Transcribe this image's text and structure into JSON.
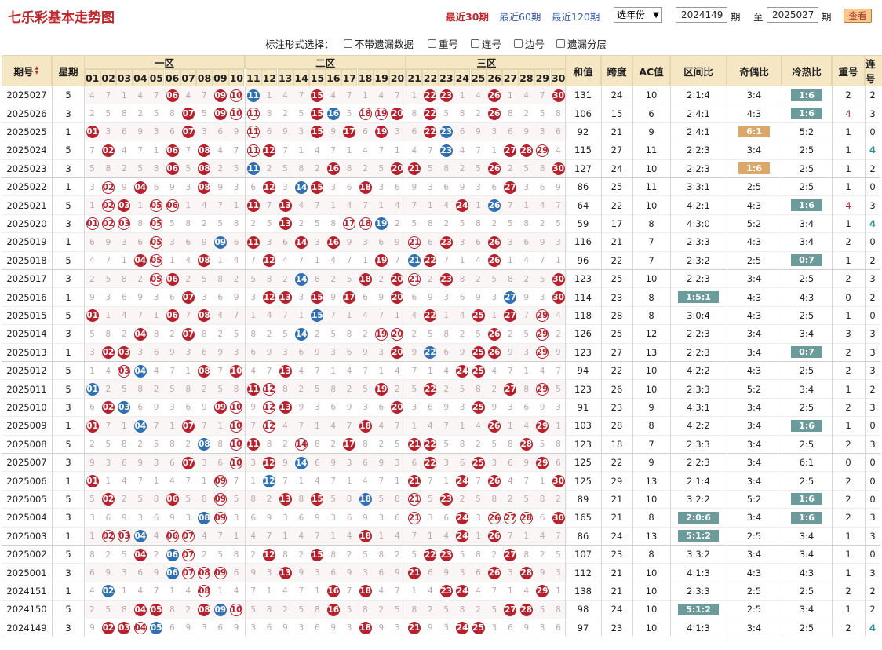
{
  "page": {
    "title": "七乐彩基本走势图",
    "periods": [
      "最近30期",
      "最近60期",
      "最近120期"
    ],
    "year_select": "选年份",
    "from_issue": "2024149",
    "to_issue": "2025027",
    "label_qi": "期",
    "label_to": "至",
    "view_button": "查看"
  },
  "options": {
    "label": "标注形式选择：",
    "items": [
      "不带遗漏数据",
      "重号",
      "连号",
      "边号",
      "遗漏分层"
    ]
  },
  "header": {
    "issue": "期号",
    "weekday": "星期",
    "zones": [
      "一区",
      "二区",
      "三区"
    ],
    "numbers": [
      "01",
      "02",
      "03",
      "04",
      "05",
      "06",
      "07",
      "08",
      "09",
      "10",
      "11",
      "12",
      "13",
      "14",
      "15",
      "16",
      "17",
      "18",
      "19",
      "20",
      "21",
      "22",
      "23",
      "24",
      "25",
      "26",
      "27",
      "28",
      "29",
      "30"
    ],
    "sum": "和值",
    "span": "跨度",
    "ac": "AC值",
    "zone_ratio": "区间比",
    "odd_even": "奇偶比",
    "hot_cold": "冷热比",
    "repeat": "重号",
    "consecutive": "连号"
  },
  "colors": {
    "red_ball": "#b8212c",
    "blue_ball": "#2f6fb3",
    "header_bg": "#f5e6c4",
    "title": "#c0272d",
    "badge_teal": "#6b9b9a",
    "badge_orange": "#dba86a"
  },
  "rows": [
    {
      "issue": "2025027",
      "wk": "5",
      "red": [
        6,
        9,
        15,
        22,
        23,
        26,
        30
      ],
      "blue": [
        11
      ],
      "ring": [
        10
      ],
      "sum": "131",
      "span": "24",
      "ac": "10",
      "zr": "2:1:4",
      "oe": "3:4",
      "hc": "1:6",
      "hcb": "teal",
      "rep": "2",
      "con": "2"
    },
    {
      "issue": "2025026",
      "wk": "3",
      "red": [
        7,
        9,
        15,
        20,
        22,
        26
      ],
      "blue": [
        16
      ],
      "ring": [
        10,
        11,
        18,
        19
      ],
      "sum": "106",
      "span": "15",
      "ac": "6",
      "zr": "2:4:1",
      "oe": "4:3",
      "hc": "1:6",
      "hcb": "teal",
      "rep": "4",
      "repc": "red",
      "con": "3"
    },
    {
      "issue": "2025025",
      "wk": "1",
      "red": [
        1,
        7,
        15,
        17,
        19,
        22
      ],
      "blue": [
        23
      ],
      "ring": [
        11
      ],
      "sum": "92",
      "span": "21",
      "ac": "9",
      "zr": "2:4:1",
      "oe": "6:1",
      "oeb": "orange",
      "hc": "5:2",
      "rep": "1",
      "con": "0"
    },
    {
      "issue": "2025024",
      "wk": "5",
      "red": [
        2,
        6,
        8,
        12,
        27,
        28
      ],
      "blue": [
        23
      ],
      "ring": [
        11,
        29
      ],
      "sum": "115",
      "span": "27",
      "ac": "11",
      "zr": "2:2:3",
      "oe": "3:4",
      "hc": "2:5",
      "rep": "1",
      "con": "4",
      "conc": "teal"
    },
    {
      "issue": "2025023",
      "wk": "3",
      "red": [
        6,
        8,
        16,
        20,
        21,
        26,
        30
      ],
      "blue": [
        11
      ],
      "ring": [],
      "sum": "127",
      "span": "24",
      "ac": "10",
      "zr": "2:2:3",
      "oe": "1:6",
      "oeb": "orange",
      "hc": "2:5",
      "rep": "1",
      "con": "2"
    },
    {
      "issue": "2025022",
      "wk": "1",
      "red": [
        4,
        8,
        12,
        15,
        18,
        27
      ],
      "blue": [
        14
      ],
      "ring": [
        2
      ],
      "sum": "86",
      "span": "25",
      "ac": "11",
      "zr": "3:3:1",
      "oe": "2:5",
      "hc": "2:5",
      "rep": "1",
      "con": "0"
    },
    {
      "issue": "2025021",
      "wk": "5",
      "red": [
        3,
        11,
        13,
        24
      ],
      "blue": [
        26
      ],
      "ring": [
        2,
        5,
        6
      ],
      "sum": "64",
      "span": "22",
      "ac": "10",
      "zr": "4:2:1",
      "oe": "4:3",
      "hc": "1:6",
      "hcb": "teal",
      "rep": "4",
      "repc": "red",
      "con": "3"
    },
    {
      "issue": "2025020",
      "wk": "3",
      "red": [
        13
      ],
      "blue": [
        19
      ],
      "ring": [
        1,
        2,
        3,
        5,
        17,
        18
      ],
      "sum": "59",
      "span": "17",
      "ac": "8",
      "zr": "4:3:0",
      "oe": "5:2",
      "hc": "3:4",
      "rep": "1",
      "con": "4",
      "conc": "teal"
    },
    {
      "issue": "2025019",
      "wk": "1",
      "red": [
        11,
        14,
        16,
        23,
        26
      ],
      "blue": [
        9
      ],
      "ring": [
        5,
        21
      ],
      "sum": "116",
      "span": "21",
      "ac": "7",
      "zr": "2:3:3",
      "oe": "4:3",
      "hc": "3:4",
      "rep": "2",
      "con": "0"
    },
    {
      "issue": "2025018",
      "wk": "5",
      "red": [
        4,
        8,
        12,
        19,
        22,
        26
      ],
      "blue": [
        21
      ],
      "ring": [
        5
      ],
      "sum": "96",
      "span": "22",
      "ac": "7",
      "zr": "2:3:2",
      "oe": "2:5",
      "hc": "0:7",
      "hcb": "teal",
      "rep": "1",
      "con": "2"
    },
    {
      "issue": "2025017",
      "wk": "3",
      "red": [
        6,
        18,
        20,
        23,
        30
      ],
      "blue": [
        14
      ],
      "ring": [
        5,
        21
      ],
      "sum": "123",
      "span": "25",
      "ac": "10",
      "zr": "2:2:3",
      "oe": "3:4",
      "hc": "2:5",
      "rep": "2",
      "con": "3"
    },
    {
      "issue": "2025016",
      "wk": "1",
      "red": [
        7,
        12,
        13,
        15,
        17,
        20,
        30
      ],
      "blue": [
        27
      ],
      "ring": [],
      "sum": "114",
      "span": "23",
      "ac": "8",
      "zr": "1:5:1",
      "zrb": "teal",
      "oe": "4:3",
      "hc": "4:3",
      "rep": "0",
      "con": "2"
    },
    {
      "issue": "2025015",
      "wk": "5",
      "red": [
        1,
        6,
        8,
        22,
        25,
        27
      ],
      "blue": [
        15
      ],
      "ring": [
        29
      ],
      "sum": "118",
      "span": "28",
      "ac": "8",
      "zr": "3:0:4",
      "oe": "4:3",
      "hc": "2:5",
      "rep": "1",
      "con": "0"
    },
    {
      "issue": "2025014",
      "wk": "3",
      "red": [
        4,
        7,
        26
      ],
      "blue": [
        14
      ],
      "ring": [
        19,
        20,
        29
      ],
      "sum": "126",
      "span": "25",
      "ac": "12",
      "zr": "2:2:3",
      "oe": "3:4",
      "hc": "3:4",
      "rep": "3",
      "con": "3"
    },
    {
      "issue": "2025013",
      "wk": "1",
      "red": [
        2,
        3,
        20,
        25,
        26
      ],
      "blue": [
        22
      ],
      "ring": [
        29
      ],
      "sum": "123",
      "span": "27",
      "ac": "13",
      "zr": "2:2:3",
      "oe": "3:4",
      "hc": "0:7",
      "hcb": "teal",
      "rep": "2",
      "con": "3"
    },
    {
      "issue": "2025012",
      "wk": "5",
      "red": [
        8,
        10,
        13,
        24,
        25
      ],
      "blue": [
        4
      ],
      "ring": [
        3
      ],
      "sum": "94",
      "span": "22",
      "ac": "10",
      "zr": "4:2:2",
      "oe": "4:3",
      "hc": "2:5",
      "rep": "2",
      "con": "3"
    },
    {
      "issue": "2025011",
      "wk": "5",
      "red": [
        11,
        19,
        22,
        27
      ],
      "blue": [
        1
      ],
      "ring": [
        12,
        29
      ],
      "sum": "123",
      "span": "26",
      "ac": "10",
      "zr": "2:3:3",
      "oe": "5:2",
      "hc": "3:4",
      "rep": "1",
      "con": "2"
    },
    {
      "issue": "2025010",
      "wk": "3",
      "red": [
        2,
        9,
        13,
        20,
        25
      ],
      "blue": [
        3
      ],
      "ring": [
        10,
        12
      ],
      "sum": "91",
      "span": "23",
      "ac": "9",
      "zr": "4:3:1",
      "oe": "3:4",
      "hc": "2:5",
      "rep": "2",
      "con": "3"
    },
    {
      "issue": "2025009",
      "wk": "1",
      "red": [
        1,
        7,
        18,
        26,
        29
      ],
      "blue": [
        4
      ],
      "ring": [
        10,
        12
      ],
      "sum": "103",
      "span": "28",
      "ac": "8",
      "zr": "4:2:2",
      "oe": "3:4",
      "hc": "1:6",
      "hcb": "teal",
      "rep": "1",
      "con": "0"
    },
    {
      "issue": "2025008",
      "wk": "5",
      "red": [
        11,
        17,
        21,
        22,
        28
      ],
      "blue": [
        8
      ],
      "ring": [
        10,
        14
      ],
      "sum": "123",
      "span": "18",
      "ac": "7",
      "zr": "2:3:3",
      "oe": "3:4",
      "hc": "2:5",
      "rep": "2",
      "con": "3"
    },
    {
      "issue": "2025007",
      "wk": "3",
      "red": [
        7,
        12,
        22,
        25,
        29
      ],
      "blue": [
        14
      ],
      "ring": [
        10
      ],
      "sum": "125",
      "span": "22",
      "ac": "9",
      "zr": "2:2:3",
      "oe": "3:4",
      "hc": "6:1",
      "rep": "0",
      "con": "0"
    },
    {
      "issue": "2025006",
      "wk": "1",
      "red": [
        1,
        21,
        24,
        26,
        30
      ],
      "blue": [
        12
      ],
      "ring": [
        9
      ],
      "sum": "125",
      "span": "29",
      "ac": "13",
      "zr": "2:1:4",
      "oe": "3:4",
      "hc": "2:5",
      "rep": "2",
      "con": "0"
    },
    {
      "issue": "2025005",
      "wk": "5",
      "red": [
        2,
        6,
        13,
        15,
        23
      ],
      "blue": [
        18
      ],
      "ring": [
        9,
        21
      ],
      "sum": "89",
      "span": "21",
      "ac": "10",
      "zr": "3:2:2",
      "oe": "5:2",
      "hc": "1:6",
      "hcb": "teal",
      "rep": "2",
      "con": "0"
    },
    {
      "issue": "2025004",
      "wk": "3",
      "red": [
        24,
        30
      ],
      "blue": [
        8
      ],
      "ring": [
        9,
        21,
        26,
        27,
        28
      ],
      "sum": "165",
      "span": "21",
      "ac": "8",
      "zr": "2:0:6",
      "zrb": "teal",
      "oe": "3:4",
      "hc": "1:6",
      "hcb": "teal",
      "rep": "2",
      "con": "3"
    },
    {
      "issue": "2025003",
      "wk": "1",
      "red": [
        18,
        24,
        26
      ],
      "blue": [
        4
      ],
      "ring": [
        2,
        3,
        6,
        7
      ],
      "sum": "86",
      "span": "24",
      "ac": "13",
      "zr": "5:1:2",
      "zrb": "teal",
      "oe": "2:5",
      "hc": "3:4",
      "rep": "1",
      "con": "3"
    },
    {
      "issue": "2025002",
      "wk": "5",
      "red": [
        4,
        12,
        15,
        22,
        23,
        27
      ],
      "blue": [
        6
      ],
      "ring": [
        7
      ],
      "sum": "107",
      "span": "23",
      "ac": "8",
      "zr": "3:3:2",
      "oe": "3:4",
      "hc": "3:4",
      "rep": "1",
      "con": "0"
    },
    {
      "issue": "2025001",
      "wk": "3",
      "red": [
        13,
        21,
        26,
        28
      ],
      "blue": [
        6
      ],
      "ring": [
        7,
        8,
        9
      ],
      "sum": "112",
      "span": "21",
      "ac": "10",
      "zr": "4:1:3",
      "oe": "4:3",
      "hc": "4:3",
      "rep": "1",
      "con": "3"
    },
    {
      "issue": "2024151",
      "wk": "1",
      "red": [
        16,
        18,
        23,
        24,
        29
      ],
      "blue": [
        2
      ],
      "ring": [
        8
      ],
      "sum": "138",
      "span": "21",
      "ac": "10",
      "zr": "2:3:3",
      "oe": "2:5",
      "hc": "2:5",
      "rep": "2",
      "con": "2"
    },
    {
      "issue": "2024150",
      "wk": "5",
      "red": [
        4,
        5,
        8,
        16,
        27,
        28
      ],
      "blue": [
        9
      ],
      "ring": [
        10
      ],
      "sum": "98",
      "span": "24",
      "ac": "10",
      "zr": "5:1:2",
      "zrb": "teal",
      "oe": "2:5",
      "hc": "3:4",
      "rep": "1",
      "con": "2"
    },
    {
      "issue": "2024149",
      "wk": "3",
      "red": [
        2,
        3,
        18,
        21,
        24,
        25
      ],
      "blue": [
        5
      ],
      "ring": [
        4
      ],
      "sum": "97",
      "span": "23",
      "ac": "10",
      "zr": "4:1:3",
      "oe": "3:4",
      "hc": "2:5",
      "rep": "2",
      "con": "4",
      "conc": "teal"
    }
  ]
}
